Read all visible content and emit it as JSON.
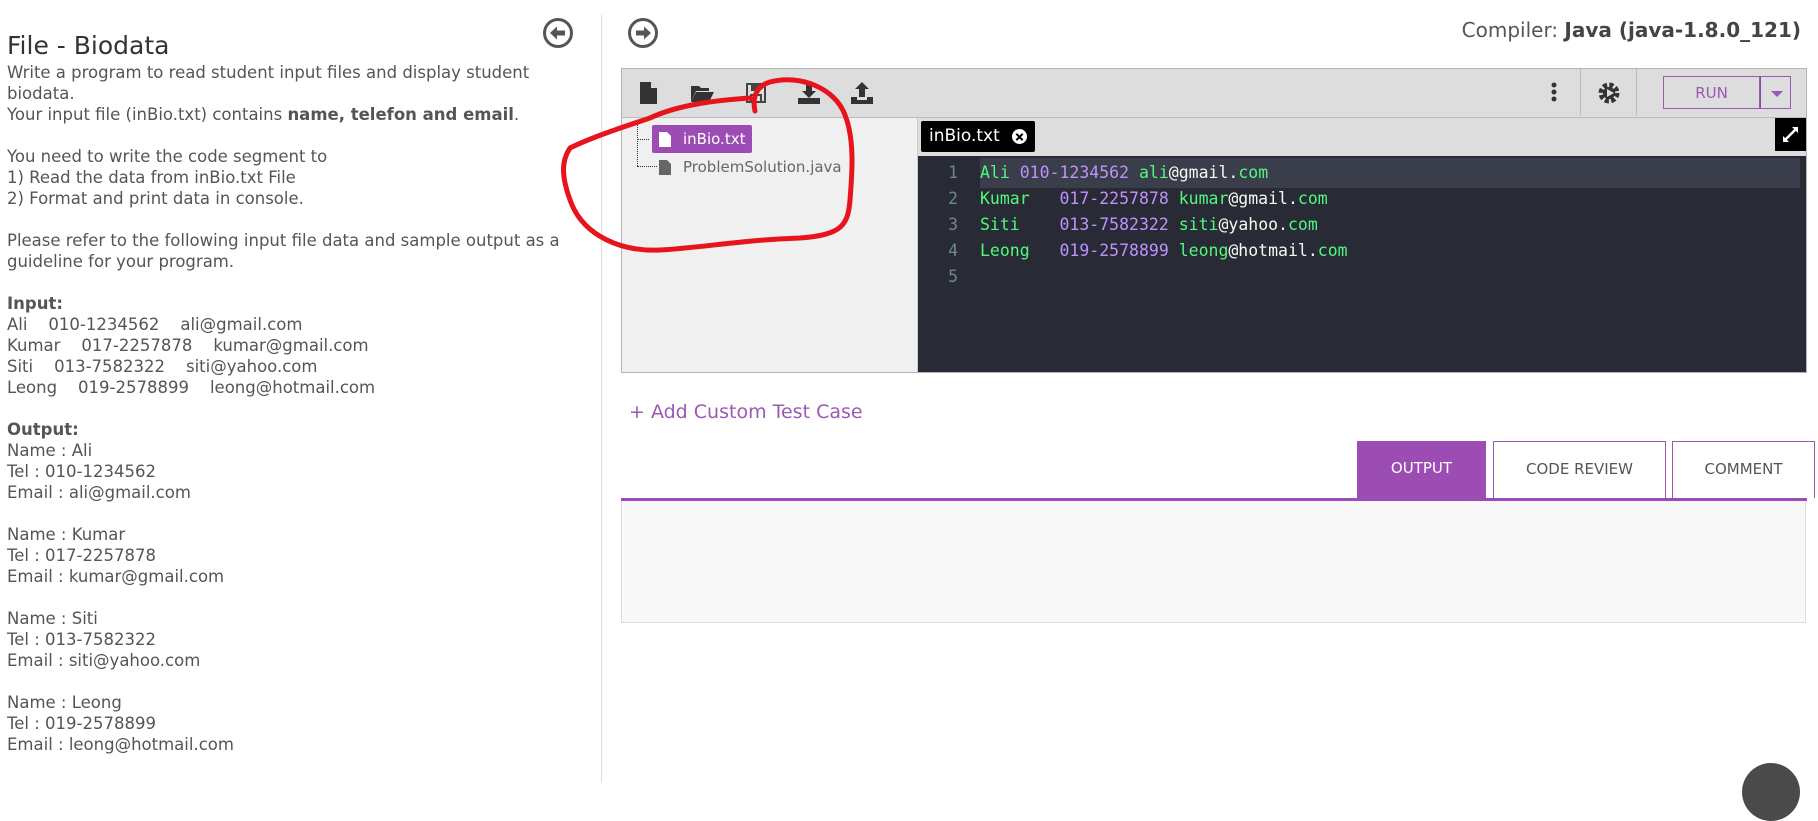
{
  "problem": {
    "title": "File - Biodata",
    "description": [
      {
        "type": "text",
        "parts": [
          {
            "t": "Write a program to read student input files and display student biodata."
          }
        ]
      },
      {
        "type": "text",
        "parts": [
          {
            "t": "Your input file (inBio.txt) contains "
          },
          {
            "t": "name, telefon and email",
            "bold": true
          },
          {
            "t": "."
          }
        ]
      },
      {
        "type": "gap"
      },
      {
        "type": "text",
        "parts": [
          {
            "t": "You need to write the code segment to"
          }
        ]
      },
      {
        "type": "text",
        "parts": [
          {
            "t": "1) Read the data from inBio.txt File"
          }
        ]
      },
      {
        "type": "text",
        "parts": [
          {
            "t": "2) Format and print data in console."
          }
        ]
      },
      {
        "type": "gap"
      },
      {
        "type": "text",
        "parts": [
          {
            "t": "Please refer to the following input file data and sample output as a guideline for your program."
          }
        ]
      },
      {
        "type": "gap"
      },
      {
        "type": "text",
        "parts": [
          {
            "t": "Input:",
            "bold": true
          }
        ]
      },
      {
        "type": "text",
        "parts": [
          {
            "t": "Ali    010-1234562    ali@gmail.com"
          }
        ]
      },
      {
        "type": "text",
        "parts": [
          {
            "t": "Kumar    017-2257878    kumar@gmail.com"
          }
        ]
      },
      {
        "type": "text",
        "parts": [
          {
            "t": "Siti    013-7582322    siti@yahoo.com"
          }
        ]
      },
      {
        "type": "text",
        "parts": [
          {
            "t": "Leong    019-2578899    leong@hotmail.com"
          }
        ]
      },
      {
        "type": "gap"
      },
      {
        "type": "text",
        "parts": [
          {
            "t": "Output:",
            "bold": true
          }
        ]
      },
      {
        "type": "text",
        "parts": [
          {
            "t": "Name : Ali"
          }
        ]
      },
      {
        "type": "text",
        "parts": [
          {
            "t": "Tel : 010-1234562"
          }
        ]
      },
      {
        "type": "text",
        "parts": [
          {
            "t": "Email : ali@gmail.com"
          }
        ]
      },
      {
        "type": "gap"
      },
      {
        "type": "text",
        "parts": [
          {
            "t": "Name : Kumar"
          }
        ]
      },
      {
        "type": "text",
        "parts": [
          {
            "t": "Tel : 017-2257878"
          }
        ]
      },
      {
        "type": "text",
        "parts": [
          {
            "t": "Email : kumar@gmail.com"
          }
        ]
      },
      {
        "type": "gap"
      },
      {
        "type": "text",
        "parts": [
          {
            "t": "Name : Siti"
          }
        ]
      },
      {
        "type": "text",
        "parts": [
          {
            "t": "Tel : 013-7582322"
          }
        ]
      },
      {
        "type": "text",
        "parts": [
          {
            "t": "Email : siti@yahoo.com"
          }
        ]
      },
      {
        "type": "gap"
      },
      {
        "type": "text",
        "parts": [
          {
            "t": "Name : Leong"
          }
        ]
      },
      {
        "type": "text",
        "parts": [
          {
            "t": "Tel : 019-2578899"
          }
        ]
      },
      {
        "type": "text",
        "parts": [
          {
            "t": "Email : leong@hotmail.com"
          }
        ]
      }
    ]
  },
  "compiler": {
    "label": "Compiler: ",
    "value": "Java (java-1.8.0_121)"
  },
  "toolbar": {
    "icons": [
      "new-file-icon",
      "open-folder-icon",
      "save-icon",
      "download-icon",
      "upload-icon"
    ],
    "more_icon": "more-vertical-icon",
    "settings_icon": "gear-run-icon",
    "run_label": "RUN"
  },
  "file_tree": [
    {
      "name": "inBio.txt",
      "selected": true
    },
    {
      "name": "ProblemSolution.java",
      "selected": false
    }
  ],
  "editor": {
    "tab_label": "inBio.txt",
    "lines": [
      {
        "n": "1",
        "tokens": [
          [
            "g",
            "Ali "
          ],
          [
            "p",
            "010-1234562 "
          ],
          [
            "g",
            "ali"
          ],
          [
            "w",
            "@gmail."
          ],
          [
            "g",
            "com"
          ]
        ]
      },
      {
        "n": "2",
        "tokens": [
          [
            "g",
            "Kumar   "
          ],
          [
            "p",
            "017-2257878 "
          ],
          [
            "g",
            "kumar"
          ],
          [
            "w",
            "@gmail."
          ],
          [
            "g",
            "com"
          ]
        ]
      },
      {
        "n": "3",
        "tokens": [
          [
            "g",
            "Siti    "
          ],
          [
            "p",
            "013-7582322 "
          ],
          [
            "g",
            "siti"
          ],
          [
            "w",
            "@yahoo."
          ],
          [
            "g",
            "com"
          ]
        ]
      },
      {
        "n": "4",
        "tokens": [
          [
            "g",
            "Leong   "
          ],
          [
            "p",
            "019-2578899 "
          ],
          [
            "g",
            "leong"
          ],
          [
            "w",
            "@hotmail."
          ],
          [
            "g",
            "com"
          ]
        ]
      },
      {
        "n": "5",
        "tokens": []
      }
    ]
  },
  "add_test_case": "+ Add Custom Test Case",
  "result_tabs": [
    {
      "label": "OUTPUT",
      "active": true
    },
    {
      "label": "CODE REVIEW",
      "active": false
    },
    {
      "label": "COMMENT",
      "active": false
    }
  ],
  "colors": {
    "accent": "#9b4db3",
    "editor_bg": "#282a36",
    "annotation": "#e8141c"
  }
}
